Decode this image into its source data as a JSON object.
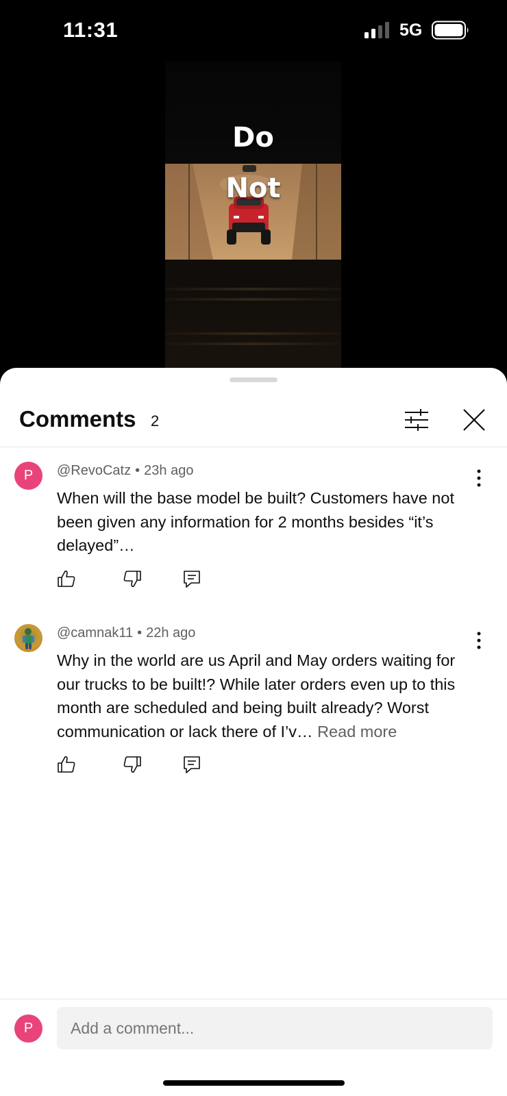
{
  "status_bar": {
    "time": "11:31",
    "network": "5G",
    "signal_icon": "signal-bars-icon",
    "battery_icon": "battery-icon"
  },
  "video": {
    "overlay_line_1": "Do",
    "overlay_line_2": "Not"
  },
  "comments_panel": {
    "title": "Comments",
    "count": "2",
    "filter_icon": "sliders-icon",
    "close_icon": "close-icon"
  },
  "comments": [
    {
      "avatar_letter": "P",
      "author": "@RevoCatz",
      "time_ago": "23h ago",
      "text": "When will the base model be built? Customers have not been given any information for 2 months besides “it’s delayed”…",
      "read_more": ""
    },
    {
      "avatar_letter": "",
      "author": "@camnak11",
      "time_ago": "22h ago",
      "text": "Why in the world are us April and May orders waiting for our trucks to be built!? While later orders even up to this month are scheduled and being built already? Worst communication or lack there of I’v…",
      "read_more": "Read more"
    }
  ],
  "separator_dot": "•",
  "composer": {
    "avatar_letter": "P",
    "placeholder": "Add a comment..."
  },
  "colors": {
    "accent_avatar": "#e8447a",
    "secondary_text": "#606060",
    "primary_text": "#0f0f0f"
  }
}
